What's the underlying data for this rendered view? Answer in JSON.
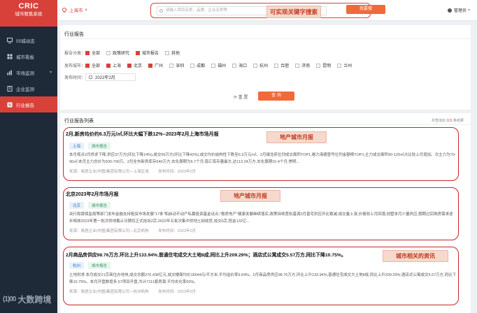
{
  "brand": {
    "name": "CRIC",
    "subtitle": "城市租售系统"
  },
  "sidebar": {
    "items": [
      {
        "label": "55城动态",
        "active": false,
        "icon": "monitor-icon"
      },
      {
        "label": "城市看板",
        "active": false,
        "icon": "board-icon"
      },
      {
        "label": "市场监测",
        "active": false,
        "icon": "chart-icon",
        "expandable": true
      },
      {
        "label": "企业监测",
        "active": false,
        "icon": "building-icon"
      },
      {
        "label": "行业报告",
        "active": true,
        "icon": "report-icon"
      }
    ]
  },
  "watermark": {
    "glyph": "(1)00",
    "text": "大数跨境"
  },
  "topbar": {
    "city": "上海市",
    "search_placeholder": "请输入项目名称、品牌、企业名称等",
    "search_annotation": "可实现关键字搜索",
    "search_button": "我要搜",
    "user": "管理员"
  },
  "filters": {
    "panel_title": "行业报告",
    "category_label": "报告分类：",
    "categories": [
      {
        "label": "全部",
        "checked": true
      },
      {
        "label": "政策研究",
        "checked": false
      },
      {
        "label": "城市报告",
        "checked": true
      },
      {
        "label": "其他",
        "checked": false
      }
    ],
    "city_label": "发布城市：",
    "cities": [
      {
        "label": "全部",
        "checked": true
      },
      {
        "label": "上海",
        "checked": true
      },
      {
        "label": "北京",
        "checked": true
      },
      {
        "label": "广州",
        "checked": true
      },
      {
        "label": "深圳",
        "checked": false
      },
      {
        "label": "成都",
        "checked": false
      },
      {
        "label": "福州",
        "checked": false
      },
      {
        "label": "海口",
        "checked": false
      },
      {
        "label": "杭州",
        "checked": false
      },
      {
        "label": "合肥",
        "checked": false
      },
      {
        "label": "济南",
        "checked": false
      },
      {
        "label": "昆明",
        "checked": false
      },
      {
        "label": "兰州",
        "checked": false
      }
    ],
    "time_label": "发布时间：",
    "time_value": "2022年2月",
    "reset_label": "重 置",
    "query_label": "查 询"
  },
  "list": {
    "title": "行业报告列表",
    "total_prefix": "共查询出",
    "total_count": "101",
    "total_suffix": "条结果",
    "items": [
      {
        "title": "2月,新房均价约6.3万元/㎡,环比大幅下跌12%--2023年2月上海市场月报",
        "tags": [
          "上海",
          "城市报告"
        ],
        "body": "本月视点2月供求下降,供应37万方(环比下降14%),成交56万方(环比下降42%),成交均价结构性下跌至6.3万元/㎡。2月镂龙府位列成交面积TOP1,格力海德壹号位列金额榜TOP1;主力成交面积90-120㎡占比较上月增加。次主力为70-90㎡;本月主力总价为500-700万。2月全市新房库存540万方,去化周期为6.7个月;南汇库存量最大,达113.24万方,去化周期10.4个月,崇明...",
        "source": "来源：易居企业(中国)集团有限公司—上海区域",
        "date": "发布时间：2023年2月",
        "annotation": "地产城市月报"
      },
      {
        "title": "北京2023年2月市场月报",
        "tags": [
          "北京",
          "城市报告"
        ],
        "body": "央行和银保监局等部门发布金融支持租赁市场发展\"17条\"和启动不动产私募投资基金试点;\"稳房地产\"健康发展继续落实,政策持续宽松基调2月普宅供应环比稳减,成交量上涨,价格较上月回落;别墅本月少量供应,假期过后购房需求逐步释放2023年第一批次供地截止日期仅正式挂出2宗;2022年五批次集中供地土拍收官,成交6宗,揽金132亿...",
        "source": "来源：易居企业(中国)集团有限公司—北京机构",
        "date": "发布时间：2023年2月",
        "annotation": "地产城市月报"
      },
      {
        "title": "2月商品房供应98.76万方,环比上升133.94%,普通住宅成交大土地8成,同比上升209.29%；酒店式公寓成交5.57万方,同比下降10.75%。",
        "tags": [
          "杭州",
          "城市报告"
        ],
        "body": "土地供求:本月成交21宗商住办地块,成交总额276.438亿元,成交楼面均价16644元/平方米,平均溢价率9.64%。2月商品房供应98.76万方,环比上升133.94%,普通住宅成交大土地8成,同比上升209.29%;酒店式公寓成交5.57万方,同比下降10.75%。本月开盘数增多,57项目开盘,共计7111套房源,平均去化率60%。",
        "source": "来源：易居企业(中国)集团有限公司—杭州机构",
        "date": "发布时间：2023年2月",
        "annotation": "城市相关的资讯"
      }
    ]
  },
  "colors": {
    "accent": "#d8413a",
    "sidebar_bg": "#1e2a38",
    "button": "#f06a38"
  }
}
